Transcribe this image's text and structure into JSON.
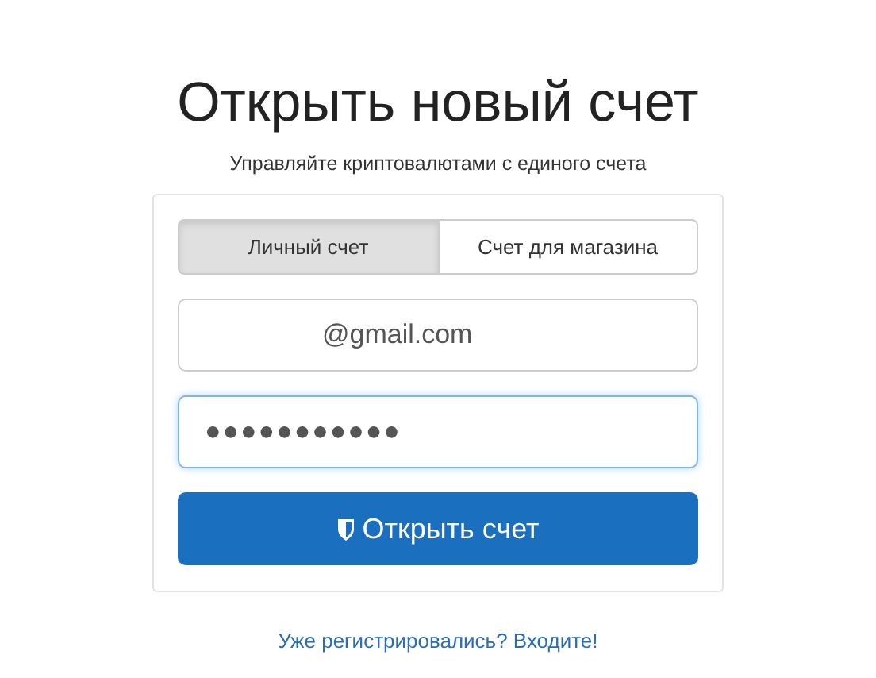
{
  "title": "Открыть новый счет",
  "subtitle": "Управляйте криптовалютами с единого счета",
  "tabs": [
    {
      "label": "Личный счет",
      "selected": true
    },
    {
      "label": "Счет для магазина",
      "selected": false
    }
  ],
  "email_field": {
    "value": "@gmail.com",
    "focused": false
  },
  "password_field": {
    "value": "●●●●●●●●●●●",
    "focused": true
  },
  "submit_button": {
    "label": "Открыть счет"
  },
  "login_link": "Уже регистрировались? Входите!"
}
